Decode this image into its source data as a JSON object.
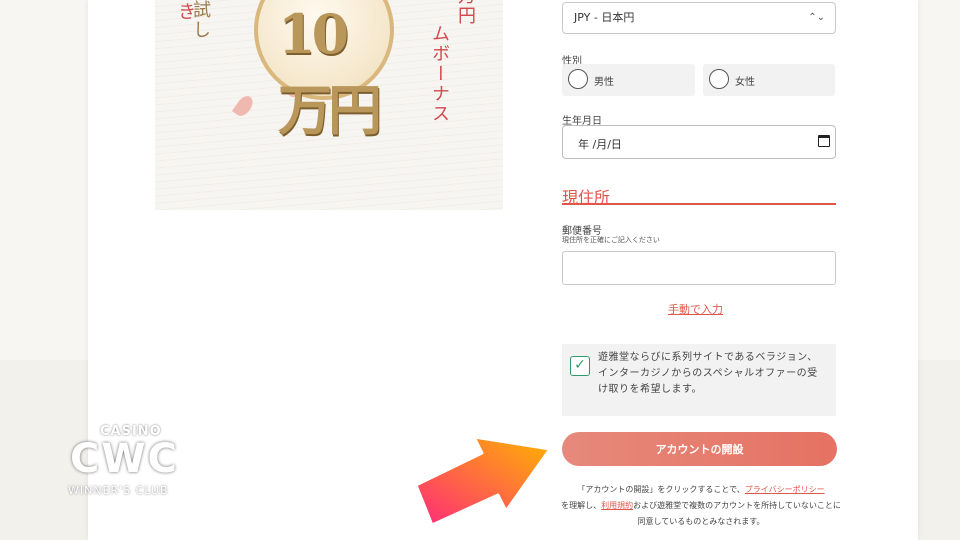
{
  "promo": {
    "col1": "お試し",
    "col1b": "付き",
    "coin": "10万円",
    "col3": "万円",
    "col4": "ムボーナス"
  },
  "currency": {
    "value": "JPY - 日本円"
  },
  "gender": {
    "label": "性別",
    "options": [
      "男性",
      "女性"
    ]
  },
  "birthdate": {
    "label": "生年月日",
    "value": "年 /月/日"
  },
  "address": {
    "section_title": "現住所",
    "postal_label": "郵便番号",
    "postal_hint": "現住所を正確にご記入ください",
    "postal_value": "",
    "manual_link": "手動で入力"
  },
  "optin": {
    "checked": true,
    "text": "遊雅堂ならびに系列サイトであるベラジョン、インターカジノからのスペシャルオファーの受け取りを希望します。"
  },
  "submit": {
    "label": "アカウントの開設"
  },
  "terms": {
    "part1": "「アカウントの開設」をクリックすることで、",
    "privacy_link": "プライバシーポリシー",
    "part2": "を理解し、",
    "terms_link": "利用規約",
    "part3": "および遊雅堂で複数のアカウントを所持していないことに同意しているものとみなされます。"
  },
  "logo": {
    "casino": "CASINO",
    "cwc": "CWC",
    "winners": "WINNER'S CLUB"
  },
  "colors": {
    "accent": "#e0574a",
    "button": "#e57262",
    "check": "#2e9a68"
  }
}
